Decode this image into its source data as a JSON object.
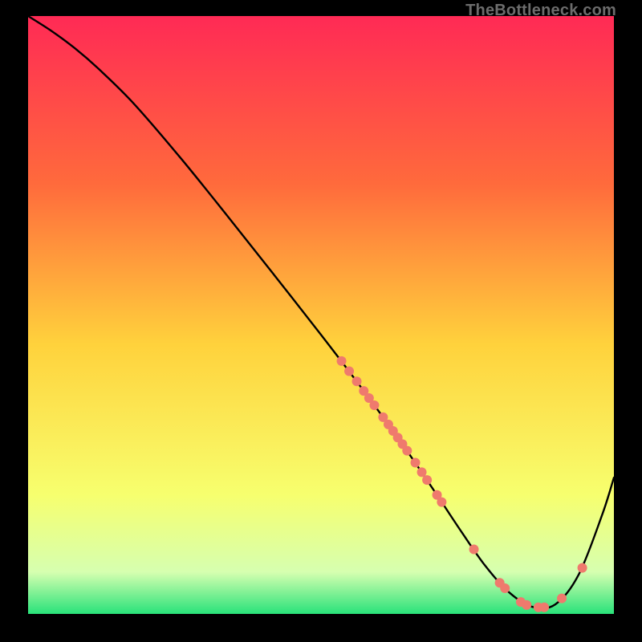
{
  "watermark": "TheBottleneck.com",
  "chart_data": {
    "type": "line",
    "title": "",
    "xlabel": "",
    "ylabel": "",
    "xlim": [
      0,
      100
    ],
    "ylim": [
      0,
      100
    ],
    "grid": false,
    "legend": false,
    "background_gradient": {
      "top": "#ff2a55",
      "upper_mid": "#ff6a3c",
      "mid": "#ffd23c",
      "lower_mid": "#f7ff6e",
      "near_bottom": "#d6ffb0",
      "bottom": "#29e27a"
    },
    "series": [
      {
        "name": "bottleneck-curve",
        "color": "#000000",
        "x": [
          0,
          4,
          8,
          12,
          18,
          26,
          34,
          42,
          50,
          56,
          62,
          66,
          70,
          74,
          78,
          82,
          86,
          90,
          94,
          98,
          100
        ],
        "y": [
          100,
          97.5,
          94.6,
          91.2,
          85.4,
          76.3,
          66.6,
          56.7,
          46.7,
          39,
          31,
          25.4,
          19.6,
          13.7,
          8.1,
          3.7,
          1.2,
          1.6,
          6.6,
          16.6,
          22.8
        ]
      }
    ],
    "markers": [
      {
        "name": "curve-dots",
        "color": "#ef7a6d",
        "radius": 6,
        "points": [
          {
            "x": 53.5,
            "y": 42.3
          },
          {
            "x": 54.8,
            "y": 40.6
          },
          {
            "x": 56.1,
            "y": 38.9
          },
          {
            "x": 57.3,
            "y": 37.3
          },
          {
            "x": 58.2,
            "y": 36.1
          },
          {
            "x": 59.1,
            "y": 34.9
          },
          {
            "x": 60.6,
            "y": 32.9
          },
          {
            "x": 61.5,
            "y": 31.7
          },
          {
            "x": 62.3,
            "y": 30.6
          },
          {
            "x": 63.1,
            "y": 29.5
          },
          {
            "x": 63.9,
            "y": 28.4
          },
          {
            "x": 64.7,
            "y": 27.3
          },
          {
            "x": 66.1,
            "y": 25.3
          },
          {
            "x": 67.2,
            "y": 23.7
          },
          {
            "x": 68.1,
            "y": 22.4
          },
          {
            "x": 69.8,
            "y": 19.9
          },
          {
            "x": 70.6,
            "y": 18.7
          },
          {
            "x": 76.1,
            "y": 10.8
          },
          {
            "x": 80.5,
            "y": 5.2
          },
          {
            "x": 81.4,
            "y": 4.3
          },
          {
            "x": 84.1,
            "y": 2
          },
          {
            "x": 85.1,
            "y": 1.5
          },
          {
            "x": 87.1,
            "y": 1.1
          },
          {
            "x": 88.1,
            "y": 1.1
          },
          {
            "x": 91.1,
            "y": 2.6
          },
          {
            "x": 94.6,
            "y": 7.7
          }
        ]
      }
    ]
  }
}
